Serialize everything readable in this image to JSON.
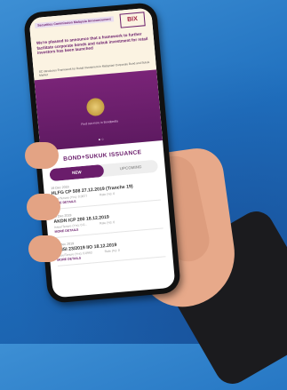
{
  "banner": {
    "tag": "Securities Commission Malaysia Announcement",
    "logo": "BIX",
    "headline": "We're pleased to announce that a framework to further facilitate corporate bonds and sukuk investment for retail investors has been launched",
    "subtext": "SC introduces Framework for Retail Investment in Malaysian Corporate Bond and Sukuk Market",
    "footer": "Find out more in Bondpedia",
    "dots": "● ○"
  },
  "app": {
    "section_title": "BOND+SUKUK ISSUANCE",
    "tabs": [
      "NEW",
      "UPCOMING"
    ]
  },
  "issuances": [
    {
      "date": "19 Dec 2019",
      "name": "HLFG CP 508 27.12.2019 (Tranche 19)",
      "tenure": "Issue/Tenure (Yrs): 0.0877",
      "rate": "Rate (%): 0",
      "link": "MORE DETAILS"
    },
    {
      "date": "19 Dec 2019",
      "name": "AKDN ICP 200 18.12.2019",
      "tenure": "Issue/Tenure (Yrs): 0.0...",
      "rate": "Rate (%): 0",
      "link": "MORE DETAILS"
    },
    {
      "date": "19 Dec 2019",
      "name": "BNSI 23/2019 IIO 18.12.2019",
      "tenure": "Issue/Tenure (Yrs): 0.0993",
      "rate": "Rate (%): 0",
      "link": "MORE DETAILS"
    }
  ]
}
